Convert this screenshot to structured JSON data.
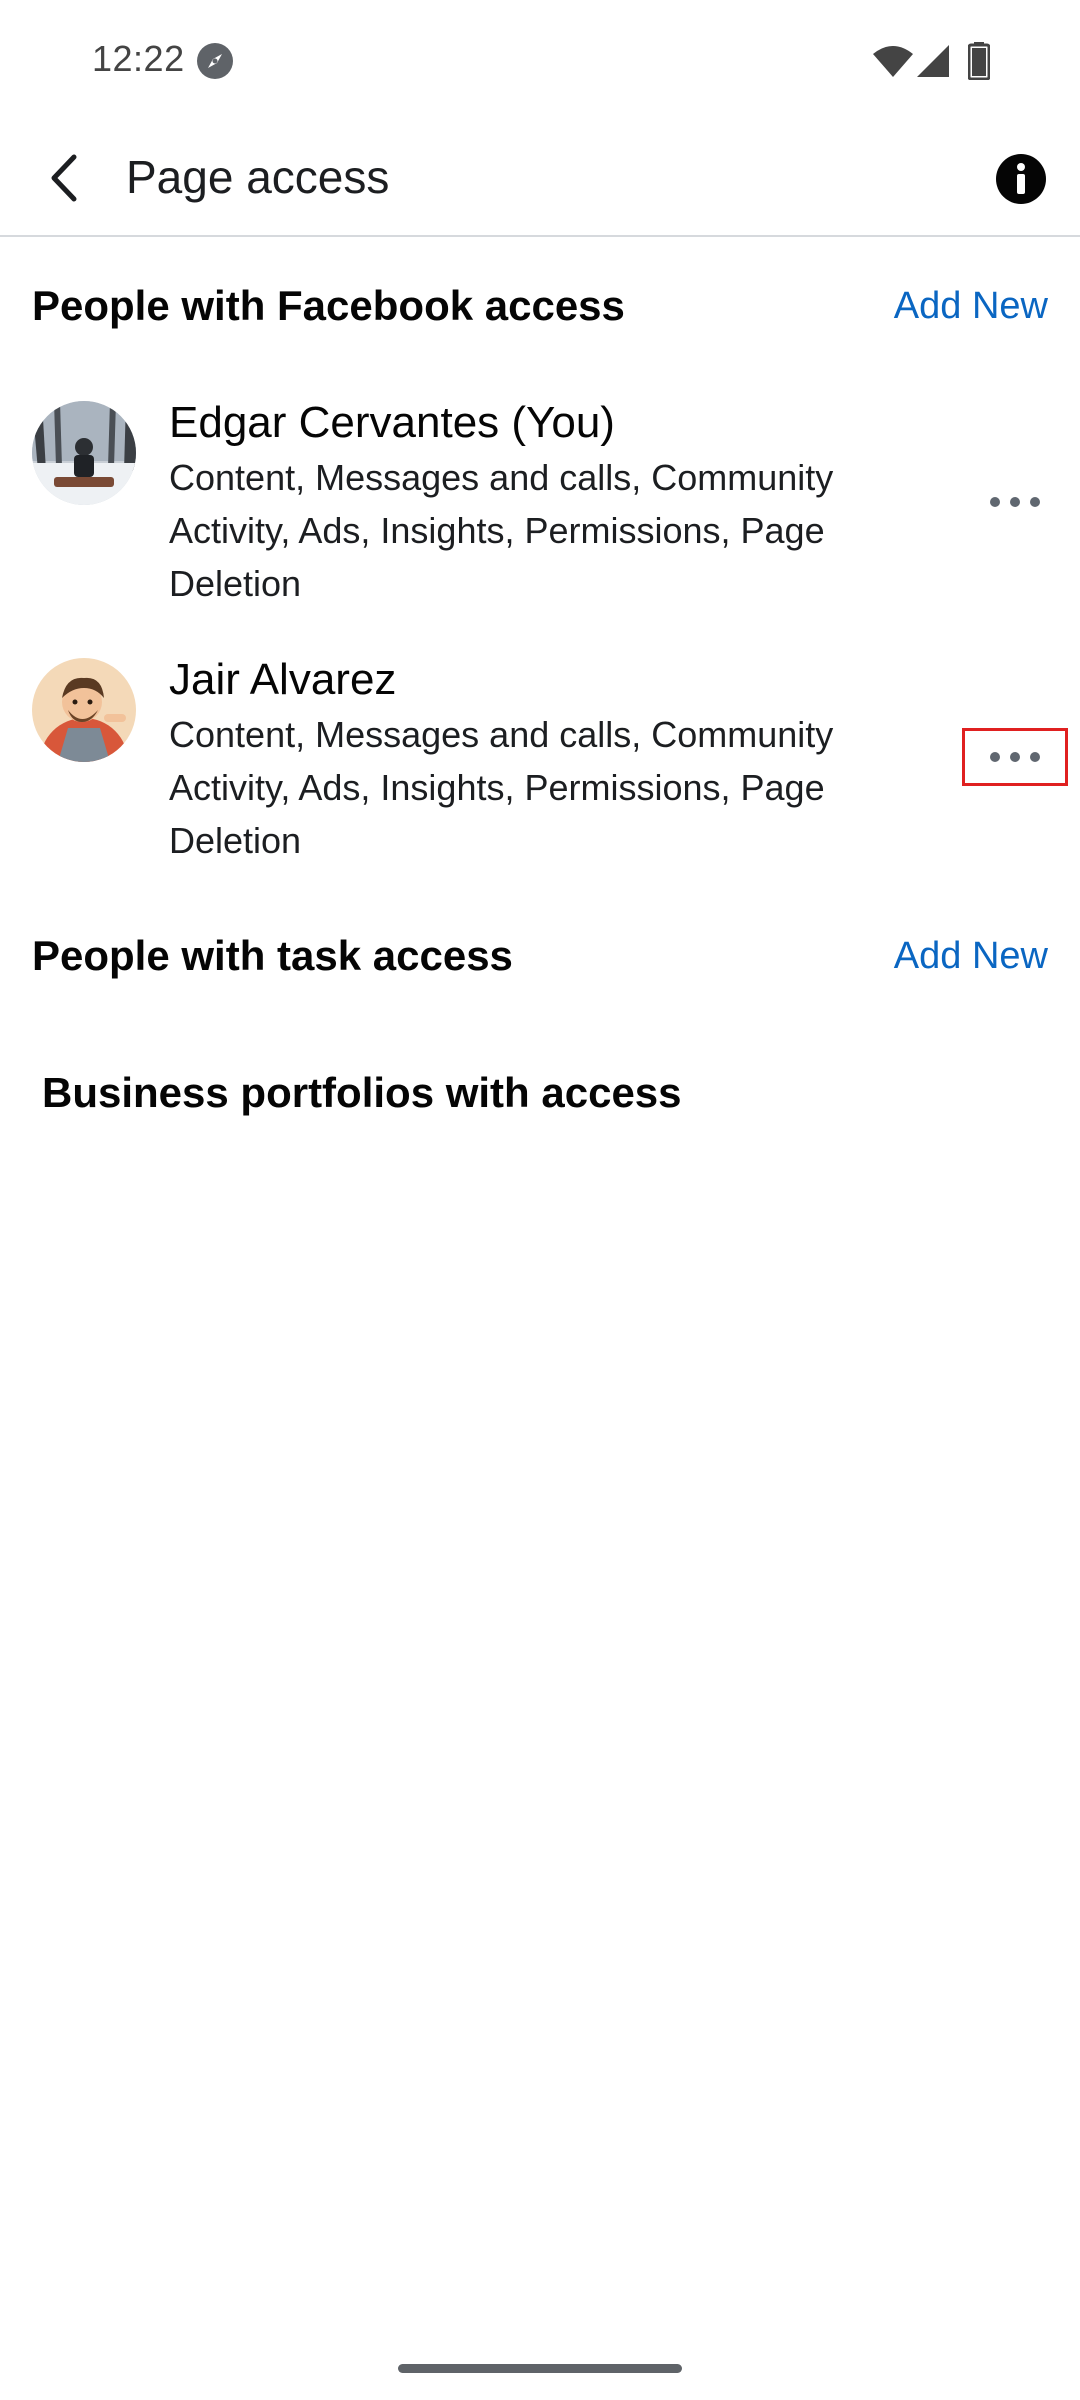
{
  "status_bar": {
    "time": "12:22",
    "icons": [
      "compass-icon",
      "wifi-icon",
      "signal-icon",
      "battery-icon"
    ]
  },
  "app_bar": {
    "title": "Page access",
    "back_icon": "chevron-left-icon",
    "info_icon": "info-icon"
  },
  "facebook_access": {
    "title": "People with Facebook access",
    "add_new_label": "Add New",
    "people": [
      {
        "name": "Edgar Cervantes (You)",
        "permissions": "Content, Messages and calls, Community Activity, Ads, Insights, Permissions, Page Deletion"
      },
      {
        "name": "Jair Alvarez",
        "permissions": "Content, Messages and calls, Community Activity, Ads, Insights, Permissions, Page Deletion"
      }
    ]
  },
  "task_access": {
    "title": "People with task access",
    "add_new_label": "Add New"
  },
  "business_portfolios": {
    "title": "Business portfolios with access"
  },
  "colors": {
    "link_blue": "#0a66c2",
    "highlight_red": "#e02020",
    "divider": "#d6d9dd"
  }
}
